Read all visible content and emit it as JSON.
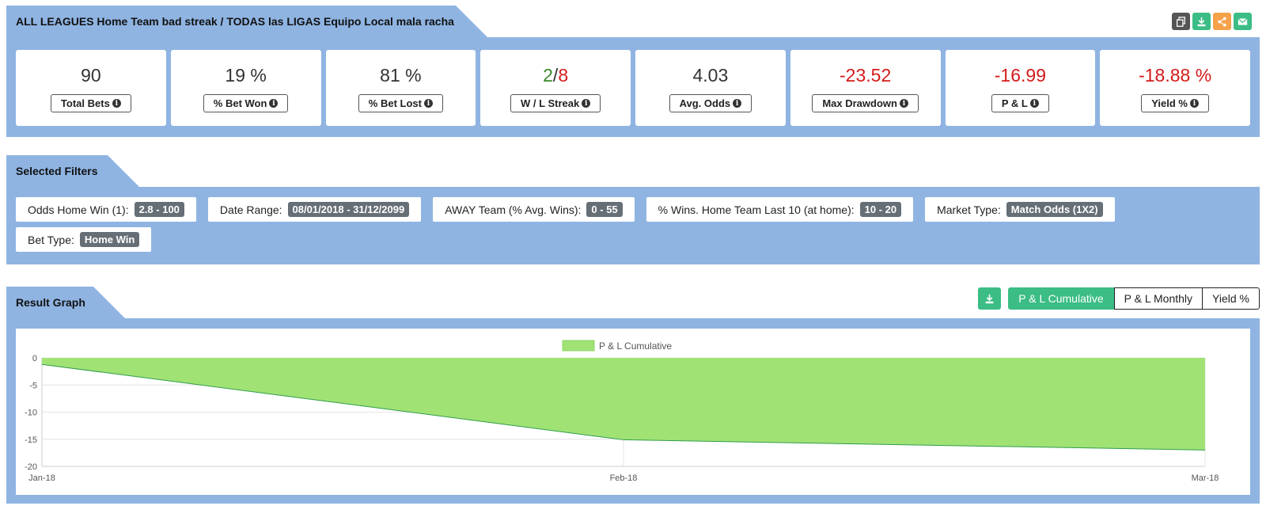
{
  "stats_header": {
    "title": "ALL LEAGUES Home Team bad streak / TODAS las LIGAS Equipo Local mala racha",
    "icons": [
      {
        "name": "copy-icon",
        "color": "#555555"
      },
      {
        "name": "download-icon",
        "color": "#3bbd85"
      },
      {
        "name": "share-icon",
        "color": "#f5a24b"
      },
      {
        "name": "email-icon",
        "color": "#3bbd85"
      }
    ]
  },
  "stats": {
    "total_bets": {
      "value": "90",
      "label": "Total Bets"
    },
    "bet_won": {
      "value": "19 %",
      "label": "% Bet Won"
    },
    "bet_lost": {
      "value": "81 %",
      "label": "% Bet Lost"
    },
    "wl_streak": {
      "won": "2",
      "sep": "/",
      "lost": "8",
      "label": "W / L Streak"
    },
    "avg_odds": {
      "value": "4.03",
      "label": "Avg. Odds"
    },
    "max_drawdown": {
      "value": "-23.52",
      "label": "Max Drawdown"
    },
    "pl": {
      "value": "-16.99",
      "label": "P & L"
    },
    "yield": {
      "value": "-18.88 %",
      "label": "Yield %"
    }
  },
  "filters": {
    "title": "Selected Filters",
    "items": [
      {
        "label": "Odds Home Win (1):",
        "value": "2.8 - 100"
      },
      {
        "label": "Date Range:",
        "value": "08/01/2018 - 31/12/2099"
      },
      {
        "label": "AWAY Team (% Avg. Wins):",
        "value": "0 - 55"
      },
      {
        "label": "% Wins. Home Team Last 10 (at home):",
        "value": "10 - 20"
      },
      {
        "label": "Market Type:",
        "value": "Match Odds (1X2)"
      },
      {
        "label": "Bet Type:",
        "value": "Home Win"
      }
    ]
  },
  "graph": {
    "title": "Result Graph",
    "buttons": {
      "pl_cumulative": "P & L Cumulative",
      "pl_monthly": "P & L Monthly",
      "yield": "Yield %"
    }
  },
  "chart_data": {
    "type": "area",
    "x": [
      "Jan-18",
      "Feb-18",
      "Mar-18"
    ],
    "series": [
      {
        "name": "P & L Cumulative",
        "values": [
          -1.2,
          -15.1,
          -16.99
        ],
        "color": "#a1e275",
        "line_color": "#2f9e4a"
      }
    ],
    "y_ticks": [
      0,
      -5,
      -10,
      -15,
      -20
    ],
    "ylim": [
      -20,
      0
    ],
    "legend_position": "top-center",
    "grid": true
  }
}
